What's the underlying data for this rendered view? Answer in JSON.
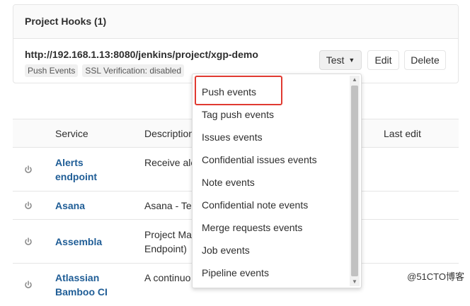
{
  "panel": {
    "title": "Project Hooks (1)",
    "hook_url": "http://192.168.1.13:8080/jenkins/project/xgp-demo",
    "badges": [
      "Push Events",
      "SSL Verification: disabled"
    ],
    "test_label": "Test",
    "edit_label": "Edit",
    "delete_label": "Delete"
  },
  "table": {
    "headers": {
      "service": "Service",
      "description": "Description",
      "last_edit": "Last edit"
    },
    "rows": [
      {
        "name_line1": "Alerts",
        "name_line2": "endpoint",
        "desc_line1": "Receive ale",
        "desc_line2": ""
      },
      {
        "name_line1": "Asana",
        "name_line2": "",
        "desc_line1": "Asana - Tea",
        "desc_line2": ""
      },
      {
        "name_line1": "Assembla",
        "name_line2": "",
        "desc_line1": "Project Ma",
        "desc_line2": "Endpoint)"
      },
      {
        "name_line1": "Atlassian",
        "name_line2": "Bamboo CI",
        "desc_line1": "A continuo",
        "desc_line2": ""
      }
    ]
  },
  "dropdown": {
    "items": [
      "Push events",
      "Tag push events",
      "Issues events",
      "Confidential issues events",
      "Note events",
      "Confidential note events",
      "Merge requests events",
      "Job events",
      "Pipeline events"
    ],
    "highlight_color": "#e03a31"
  },
  "watermark": "@51CTO博客"
}
